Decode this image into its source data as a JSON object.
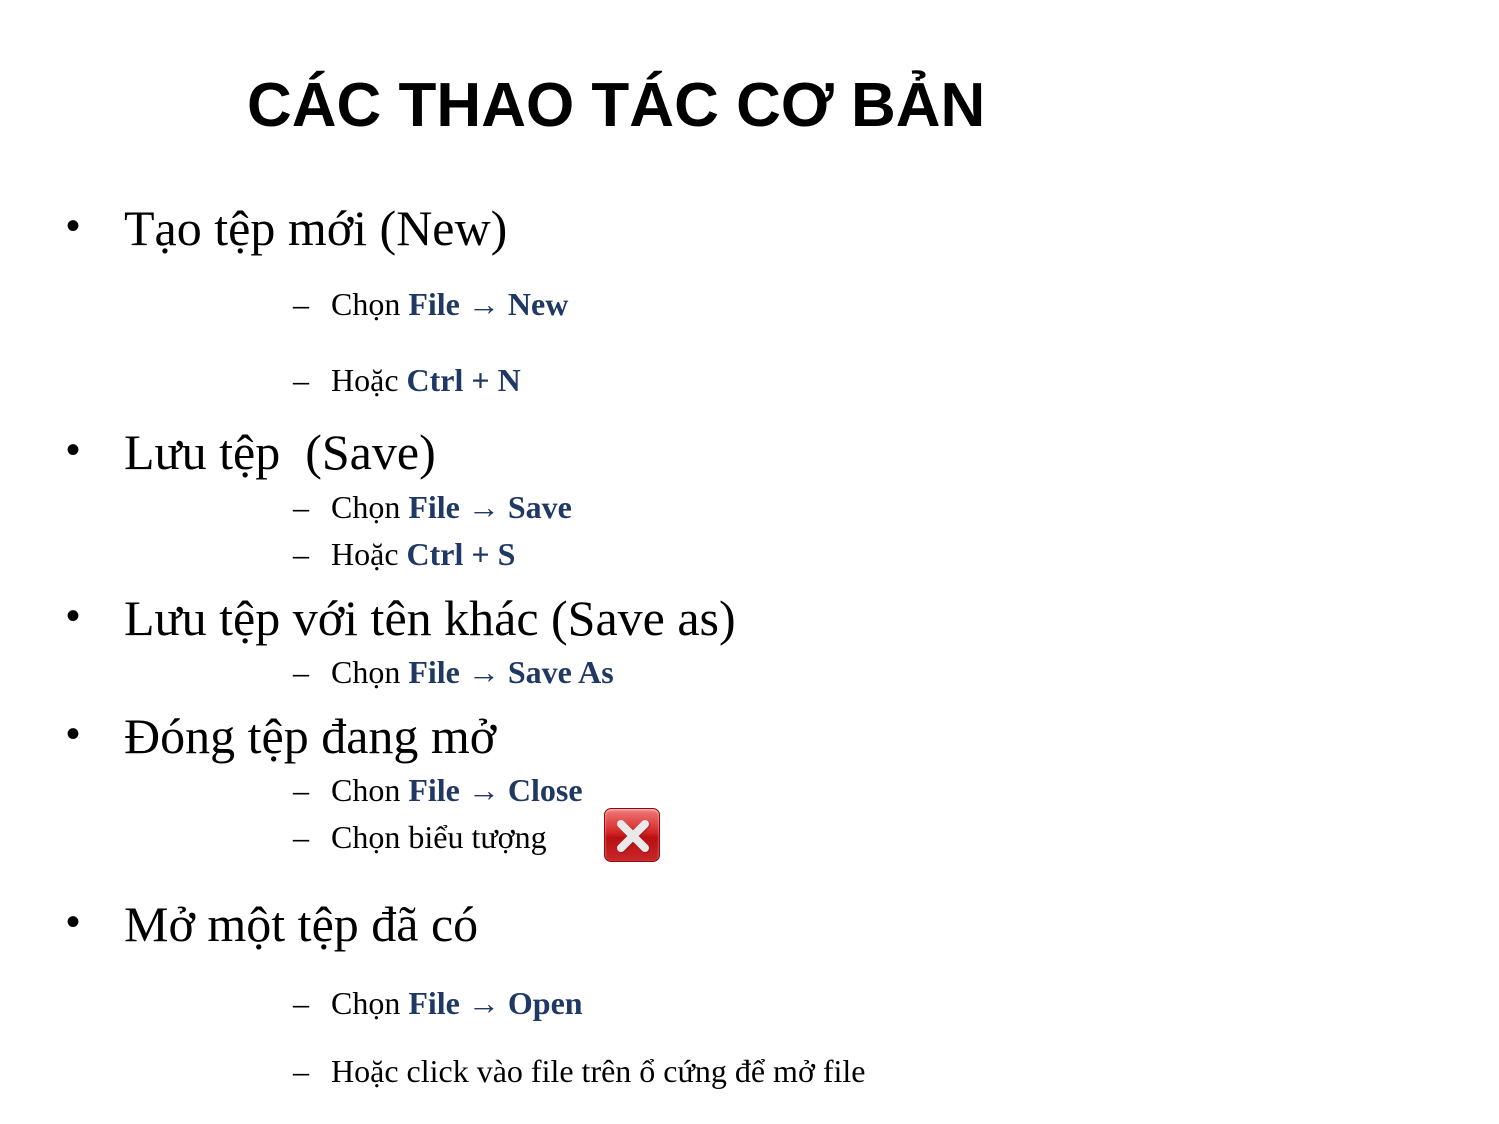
{
  "title": "CÁC THAO TÁC CƠ BẢN",
  "bullet_glyph": "•",
  "dash_glyph": "–",
  "colors": {
    "highlight": "#1f3864",
    "close_icon": "#d52525"
  },
  "sections": [
    {
      "heading": "Tạo tệp mới (New)",
      "items": [
        {
          "prefix": "Chọn ",
          "bold1": "File",
          "arrow": " → ",
          "bold2": "New"
        },
        {
          "prefix": "Hoặc ",
          "bold1": "Ctrl + N"
        }
      ]
    },
    {
      "heading": "Lưu tệp  (Save)",
      "items": [
        {
          "prefix": "Chọn ",
          "bold1": "File",
          "arrow": " → ",
          "bold2": "Save"
        },
        {
          "prefix": "Hoặc ",
          "bold1": "Ctrl + S"
        }
      ]
    },
    {
      "heading": "Lưu tệp với tên khác (Save as)",
      "items": [
        {
          "prefix": "Chọn ",
          "bold1": "File",
          "arrow": " → ",
          "bold2": "Save As"
        }
      ]
    },
    {
      "heading": "Đóng tệp đang mở",
      "items": [
        {
          "prefix": "Chon ",
          "bold1": "File",
          "arrow": " → ",
          "bold2": "Close"
        },
        {
          "prefix": "Chọn biểu tượng",
          "icon": "close-window-icon"
        }
      ]
    },
    {
      "heading": "Mở một tệp đã có",
      "items": [
        {
          "prefix": "Chọn ",
          "bold1": "File",
          "arrow": " → ",
          "bold2": "Open"
        },
        {
          "prefix": "Hoặc click vào file trên ổ cứng để mở file"
        }
      ]
    }
  ]
}
